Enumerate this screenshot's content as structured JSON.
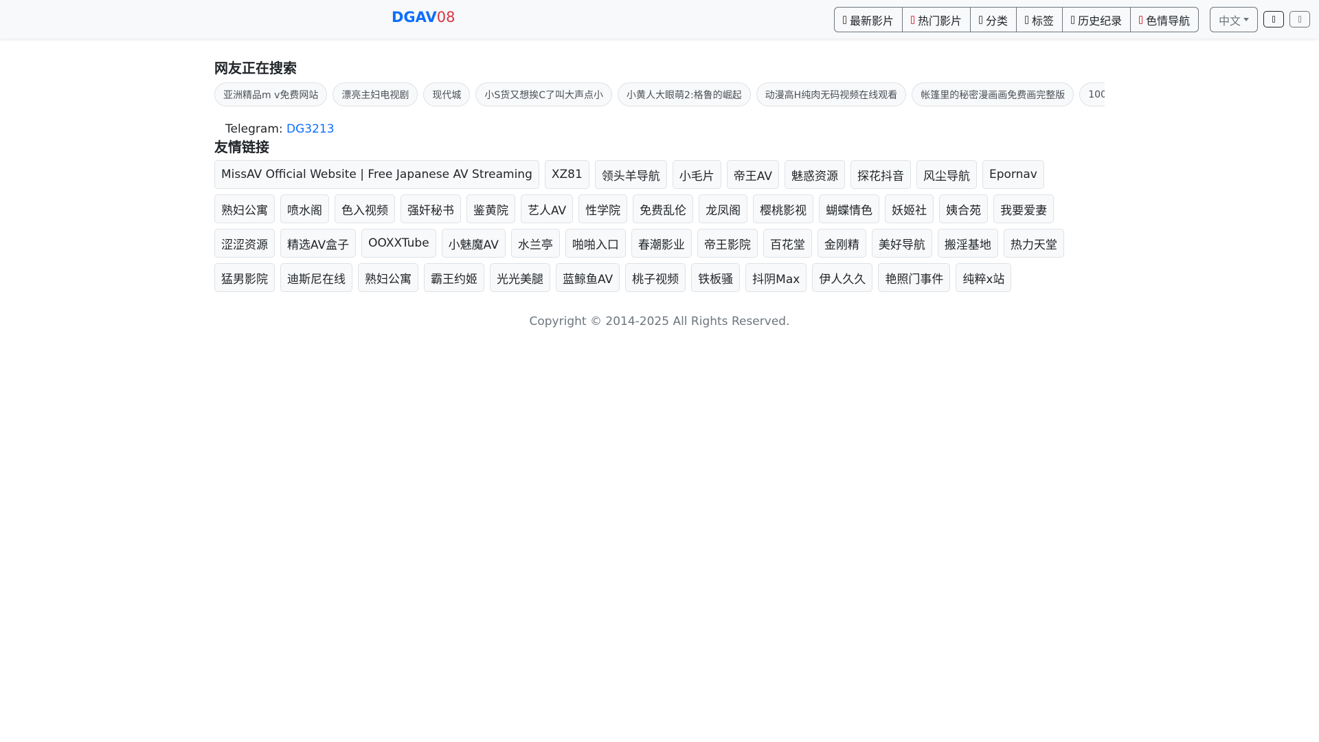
{
  "header": {
    "brand_main": "DGAV",
    "brand_suffix": "08",
    "nav": [
      {
        "label": "最新影片",
        "icon": "film-icon",
        "icon_color": "#555"
      },
      {
        "label": "热门影片",
        "icon": "fire-icon",
        "icon_color": "#dc3545"
      },
      {
        "label": "分类",
        "icon": "grid-icon",
        "icon_color": "#555"
      },
      {
        "label": "标签",
        "icon": "tag-icon",
        "icon_color": "#555"
      },
      {
        "label": "历史纪录",
        "icon": "history-icon",
        "icon_color": "#555"
      },
      {
        "label": "色情导航",
        "icon": "heart-icon",
        "icon_color": "#dc3545"
      }
    ],
    "language": "中文"
  },
  "search": {
    "title": "网友正在搜索",
    "tags": [
      "亚洲精品m v免费网站",
      "漂亮主妇电视剧",
      "现代城",
      "小S货又想挨C了叫大声点小",
      "小黄人大眼萌2:格鲁的崛起",
      "动漫高H纯肉无码视频在线观看",
      "帐篷里的秘密漫画画免费画完整版",
      "100"
    ]
  },
  "telegram": {
    "label": "Telegram:",
    "handle": "DG3213"
  },
  "friends": {
    "title": "友情链接",
    "links": [
      "MissAV Official Website | Free Japanese AV Streaming",
      "XZ81",
      "领头羊导航",
      "小毛片",
      "帝王AV",
      "魅惑资源",
      "探花抖音",
      "风尘导航",
      "Epornav",
      "熟妇公寓",
      "喷水阁",
      "色入视频",
      "强奸秘书",
      "鉴黄院",
      "艺人AV",
      "性学院",
      "免费乱伦",
      "龙凤阁",
      "樱桃影视",
      "蝴蝶情色",
      "妖姬社",
      "姨合苑",
      "我要爱妻",
      "涩涩资源",
      "精选AV盒子",
      "OOXXTube",
      "小魅魔AV",
      "水兰亭",
      "啪啪入口",
      "春潮影业",
      "帝王影院",
      "百花堂",
      "金刚精",
      "美好导航",
      "搬淫基地",
      "热力天堂",
      "猛男影院",
      "迪斯尼在线",
      "熟妇公寓",
      "霸王约姬",
      "光光美腿",
      "蓝鲸鱼AV",
      "桃子视频",
      "铁板骚",
      "抖阴Max",
      "伊人久久",
      "艳照门事件",
      "纯粹x站"
    ]
  },
  "footer": {
    "copyright": "Copyright © 2014-2025 All Rights Reserved."
  }
}
